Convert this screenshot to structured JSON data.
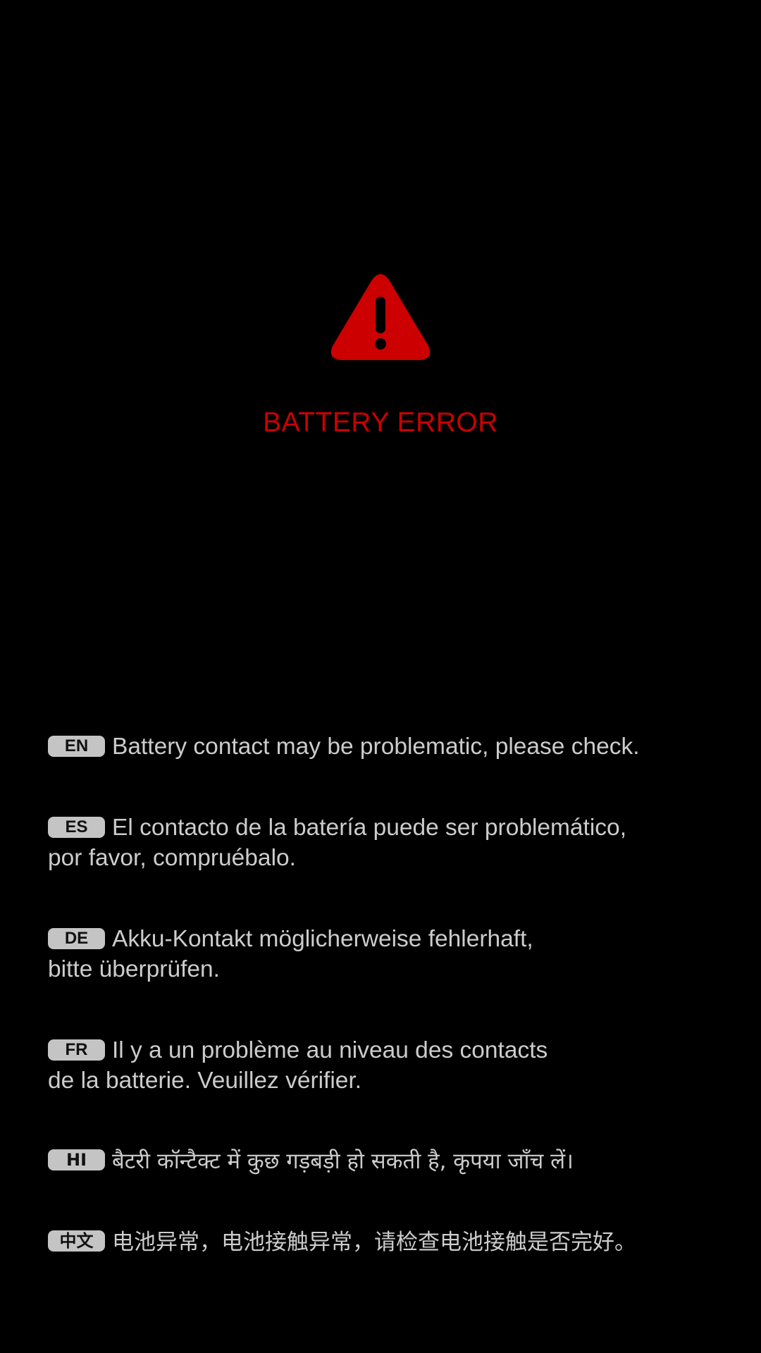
{
  "screen": {
    "icon": "warning-triangle-icon",
    "title": "BATTERY ERROR",
    "accent_color": "#cc0000",
    "background_color": "#000000"
  },
  "messages": [
    {
      "lang": "EN",
      "text": "Battery contact may be problematic, please check."
    },
    {
      "lang": "ES",
      "text": "El contacto de la batería puede ser problemático,\npor favor, compruébalo."
    },
    {
      "lang": "DE",
      "text": "Akku-Kontakt möglicherweise fehlerhaft,\nbitte überprüfen."
    },
    {
      "lang": "FR",
      "text": "Il y a un problème au niveau des contacts\nde la batterie. Veuillez vérifier."
    },
    {
      "lang": "HI",
      "text": "बैटरी कॉन्टैक्ट में कुछ गड़बड़ी हो सकती है, कृपया जाँच लें।"
    },
    {
      "lang": "中文",
      "text": "电池异常，电池接触异常，请检查电池接触是否完好。"
    }
  ]
}
